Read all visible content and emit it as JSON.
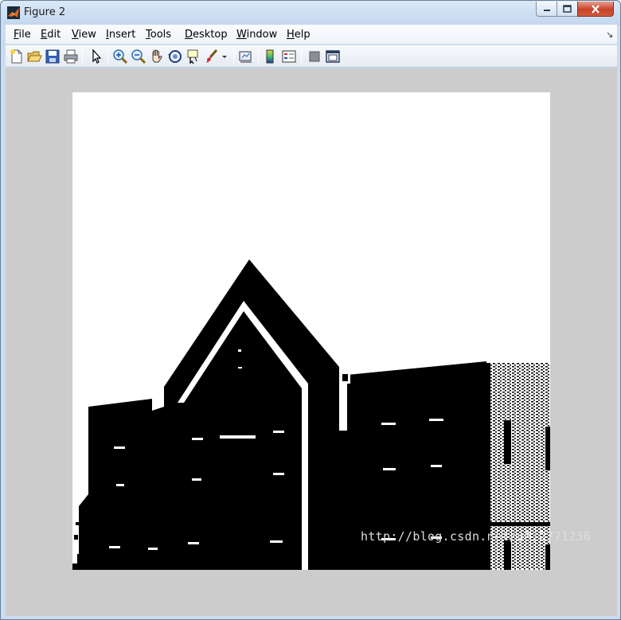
{
  "window": {
    "title": "Figure 2"
  },
  "menubar": {
    "items": [
      {
        "label": "File",
        "key": "F"
      },
      {
        "label": "Edit",
        "key": "E"
      },
      {
        "label": "View",
        "key": "V"
      },
      {
        "label": "Insert",
        "key": "I"
      },
      {
        "label": "Tools",
        "key": "T"
      },
      {
        "label": "Desktop",
        "key": "D"
      },
      {
        "label": "Window",
        "key": "W"
      },
      {
        "label": "Help",
        "key": "H"
      }
    ]
  },
  "toolbar": {
    "buttons": [
      "new-figure-icon",
      "open-file-icon",
      "save-icon",
      "print-icon",
      "edit-plot-arrow-icon",
      "zoom-in-icon",
      "zoom-out-icon",
      "pan-hand-icon",
      "rotate-3d-icon",
      "data-cursor-icon",
      "brush-icon",
      "brush-dropdown-icon",
      "link-plot-icon",
      "colorbar-icon",
      "legend-icon",
      "hide-plot-tools-icon",
      "show-plot-tools-icon"
    ]
  },
  "figure": {
    "background": "#cccccc",
    "image_description_colors": {
      "foreground": "#000000",
      "background": "#ffffff"
    }
  },
  "watermark": {
    "text": "http://blog.csdn.net/u012771236"
  }
}
